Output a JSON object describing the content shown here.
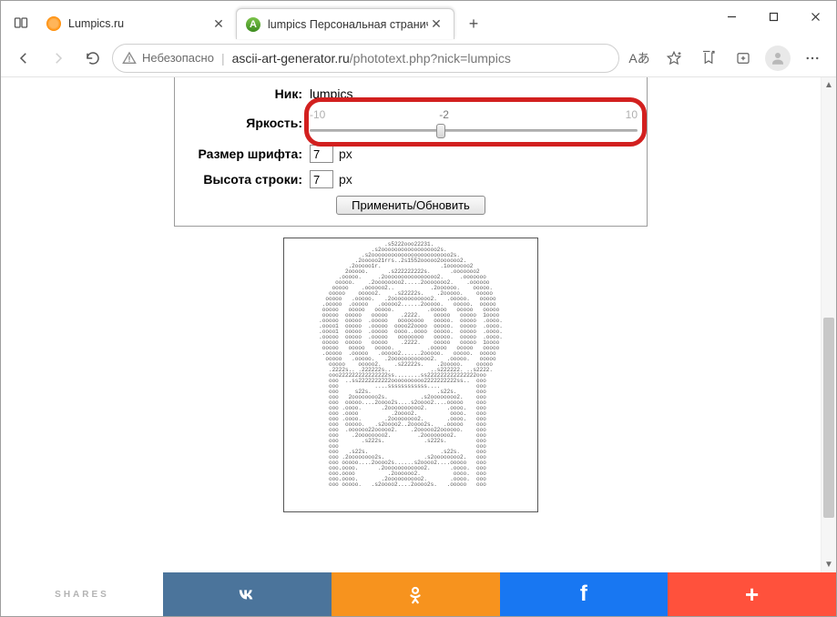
{
  "window": {
    "tab1_label": "Lumpics.ru",
    "tab2_label": "lumpics Персональная странич",
    "minimize": "—",
    "close": "✕"
  },
  "toolbar": {
    "insecure_label": "Небезопасно",
    "url_host": "ascii-art-generator.ru",
    "url_path": "/phototext.php?nick=lumpics",
    "reader": "Aあ"
  },
  "form": {
    "nick_label": "Ник:",
    "nick_value": "lumpics",
    "brightness_label": "Яркость:",
    "brightness_min": "-10",
    "brightness_val": "-2",
    "brightness_max": "10",
    "fontsize_label": "Размер шрифта:",
    "fontsize_value": "7",
    "lineheight_label": "Высота строки:",
    "lineheight_value": "7",
    "px_suffix": "px",
    "apply_label": "Применить/Обновить"
  },
  "share": {
    "title": "SHARES",
    "vk": "w",
    "fb": "f",
    "more": "+"
  }
}
